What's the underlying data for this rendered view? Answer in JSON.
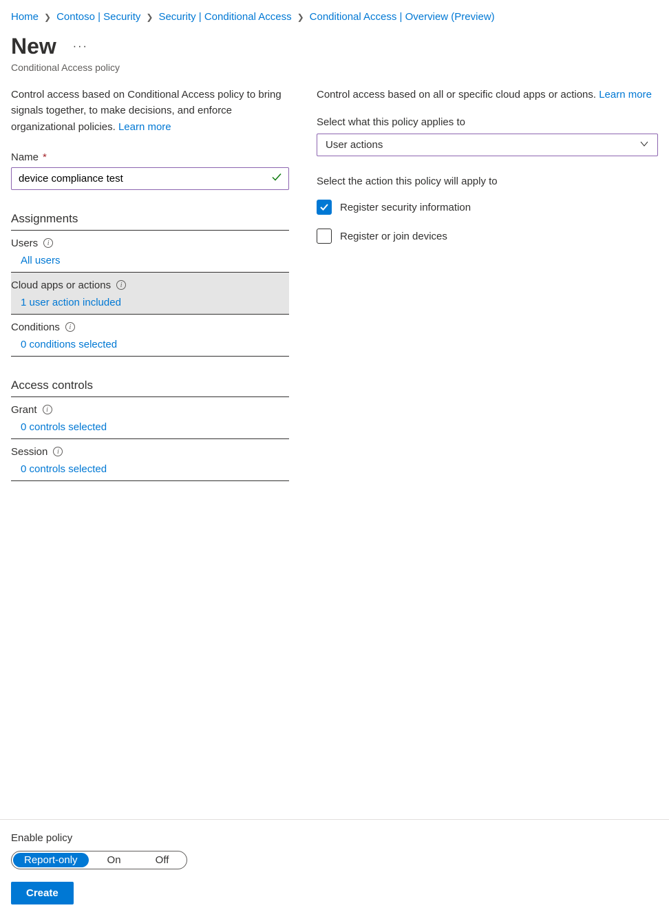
{
  "breadcrumb": [
    "Home",
    "Contoso | Security",
    "Security | Conditional Access",
    "Conditional Access | Overview (Preview)"
  ],
  "page": {
    "title": "New",
    "subtitle": "Conditional Access policy"
  },
  "left": {
    "intro_text": "Control access based on Conditional Access policy to bring signals together, to make decisions, and enforce organizational policies. ",
    "intro_link": "Learn more",
    "name_label": "Name",
    "name_value": "device compliance test",
    "assignments_heading": "Assignments",
    "users": {
      "label": "Users",
      "value": "All users"
    },
    "cloud_apps": {
      "label": "Cloud apps or actions",
      "value": "1 user action included"
    },
    "conditions": {
      "label": "Conditions",
      "value": "0 conditions selected"
    },
    "access_controls_heading": "Access controls",
    "grant": {
      "label": "Grant",
      "value": "0 controls selected"
    },
    "session": {
      "label": "Session",
      "value": "0 controls selected"
    }
  },
  "right": {
    "intro_text": "Control access based on all or specific cloud apps or actions. ",
    "intro_link": "Learn more",
    "applies_to_label": "Select what this policy applies to",
    "applies_to_value": "User actions",
    "action_label": "Select the action this policy will apply to",
    "option1": {
      "label": "Register security information",
      "checked": true
    },
    "option2": {
      "label": "Register or join devices",
      "checked": false
    }
  },
  "footer": {
    "enable_label": "Enable policy",
    "options": [
      "Report-only",
      "On",
      "Off"
    ],
    "active_index": 0,
    "create_label": "Create"
  }
}
